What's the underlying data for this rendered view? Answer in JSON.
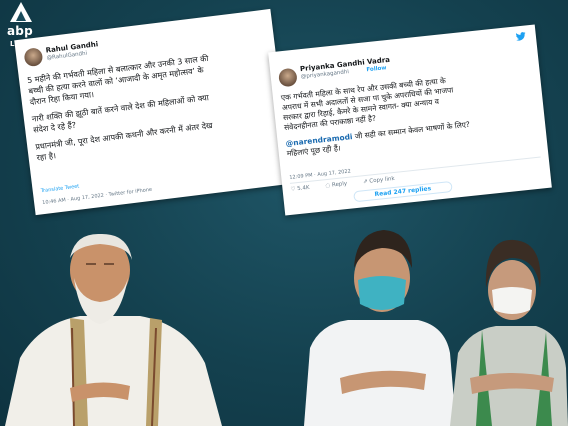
{
  "brand": {
    "name": "abp",
    "tag": "LIVE",
    "colors": {
      "background": "#14414f",
      "white": "#ffffff",
      "twitter_blue": "#1da1f2"
    }
  },
  "tweet_left": {
    "name": "Rahul Gandhi",
    "handle": "@RahulGandhi",
    "lines": [
      "5 महीने की गर्भवती महिला से बलात्कार और उनकी 3 साल की",
      "बच्ची की हत्या करने वालों को ‘आजादी के अमृत महोत्सव’ के",
      "दौरान रिहा किया गया।"
    ],
    "lines2": [
      "नारी शक्ति की झूठी बातें करने वाले देश की महिलाओं को क्या",
      "संदेश दे रहे हैं?"
    ],
    "lines3": [
      "प्रधानमंत्री जी, पूरा देश आपकी कथनी और करनी में अंतर देख",
      "रहा है।"
    ],
    "translate": "Translate Tweet",
    "meta": "10:46 AM · Aug 17, 2022 · Twitter for iPhone"
  },
  "tweet_right": {
    "name": "Priyanka Gandhi Vadra",
    "handle": "@priyankagandhi",
    "follow": "Follow",
    "lines": [
      "एक गर्भवती महिला के साथ रेप और उसकी बच्ची की हत्या के",
      "अपराध में सभी अदालतों से सजा पा चुके अपराधियों की भाजपा",
      "सरकार द्वारा रिहाई, कैमरे के सामने स्वागत- क्या अन्याय व",
      "संवेदनहीनता की पराकाष्ठा नहीं है?"
    ],
    "mention": "@narendramodi",
    "mention_text": " जी सही का सम्मान केवल भाषणों के लिए?",
    "last_line": "महिलाएं पूछ रही हैं।",
    "meta": "12:09 PM · Aug 17, 2022",
    "likes": "5.4K",
    "reply_label": "Reply",
    "copy_label": "Copy link",
    "replies_cta": "Read 247 replies"
  }
}
